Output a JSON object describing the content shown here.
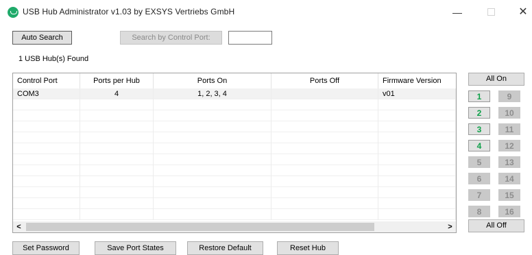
{
  "window": {
    "title": "USB Hub Administrator v1.03 by EXSYS Vertriebs GmbH",
    "min_glyph": "—",
    "close_glyph": "✕"
  },
  "toolbar": {
    "auto_search": "Auto Search",
    "search_by_port": "Search by Control Port:",
    "port_value": ""
  },
  "status": {
    "found": "1 USB Hub(s) Found"
  },
  "table": {
    "headers": [
      "Control Port",
      "Ports per Hub",
      "Ports On",
      "Ports Off",
      "Firmware Version"
    ],
    "rows": [
      [
        "COM3",
        "4",
        "1, 2, 3, 4",
        "",
        "v01"
      ]
    ]
  },
  "scroll": {
    "left_glyph": "<",
    "right_glyph": ">"
  },
  "ports": {
    "all_on": "All On",
    "all_off": "All Off",
    "left": [
      {
        "label": "1",
        "state": "on"
      },
      {
        "label": "2",
        "state": "on"
      },
      {
        "label": "3",
        "state": "on"
      },
      {
        "label": "4",
        "state": "on"
      },
      {
        "label": "5",
        "state": "off"
      },
      {
        "label": "6",
        "state": "off"
      },
      {
        "label": "7",
        "state": "off"
      },
      {
        "label": "8",
        "state": "off"
      }
    ],
    "right": [
      {
        "label": "9",
        "state": "off"
      },
      {
        "label": "10",
        "state": "off"
      },
      {
        "label": "11",
        "state": "off"
      },
      {
        "label": "12",
        "state": "off"
      },
      {
        "label": "13",
        "state": "off"
      },
      {
        "label": "14",
        "state": "off"
      },
      {
        "label": "15",
        "state": "off"
      },
      {
        "label": "16",
        "state": "off"
      }
    ]
  },
  "bottom": {
    "set_password": "Set Password",
    "save_port_states": "Save Port States",
    "restore_default": "Restore Default",
    "reset_hub": "Reset Hub"
  },
  "colors": {
    "port_on_text": "#10a04a",
    "app_icon": "#1faa6a"
  }
}
